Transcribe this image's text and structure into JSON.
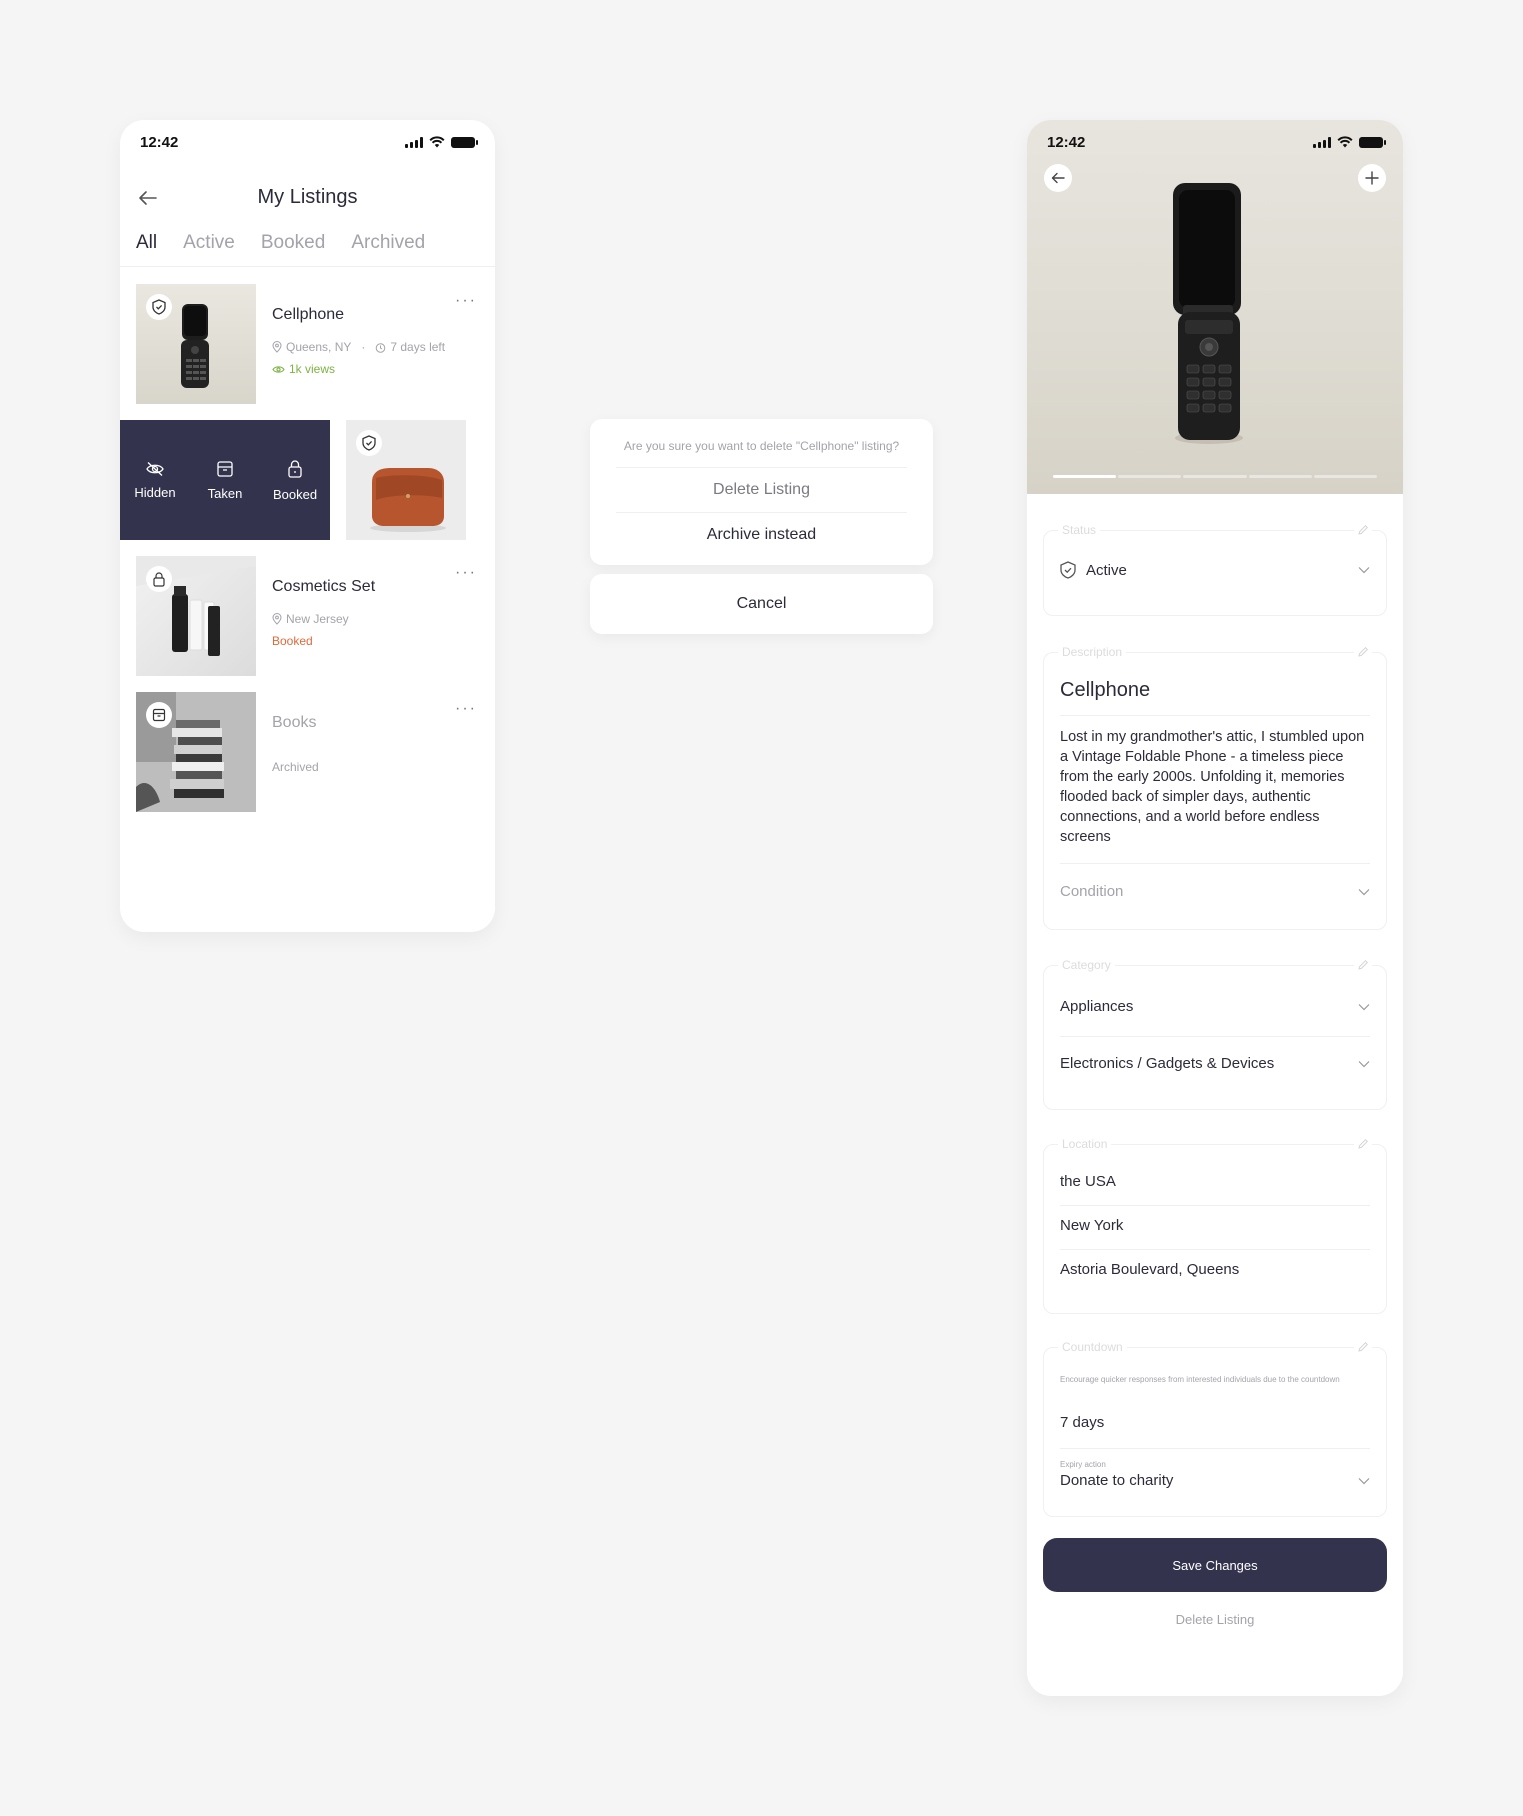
{
  "listings_screen": {
    "status_time": "12:42",
    "title": "My Listings",
    "tabs": [
      "All",
      "Active",
      "Booked",
      "Archived"
    ],
    "active_tab": "All",
    "items": [
      {
        "title": "Cellphone",
        "location": "Queens, NY",
        "countdown": "7 days left",
        "views": "1k views",
        "badge": "shield-icon"
      },
      {
        "badge": "shield-icon"
      },
      {
        "title": "Cosmetics Set",
        "location": "New Jersey",
        "status": "Booked",
        "badge": "lock-icon"
      },
      {
        "title": "Books",
        "status": "Archived",
        "badge": "archive-icon"
      }
    ],
    "swipe_actions": [
      "Hidden",
      "Taken",
      "Booked"
    ],
    "more_label": "···"
  },
  "delete_dialog": {
    "question": "Are you sure you want to delete \"Cellphone\" listing?",
    "delete_label": "Delete Listing",
    "archive_label": "Archive instead",
    "cancel_label": "Cancel"
  },
  "edit_screen": {
    "status_time": "12:42",
    "status_legend": "Status",
    "status_value": "Active",
    "description_legend": "Description",
    "title_value": "Cellphone",
    "description": "Lost in my grandmother's attic, I stumbled upon a Vintage Foldable Phone - a timeless piece from the early 2000s. Unfolding it, memories flooded back of simpler days, authentic connections, and a world before endless screens",
    "condition_placeholder": "Condition",
    "category_legend": "Category",
    "category": "Appliances",
    "subcategory": "Electronics / Gadgets & Devices",
    "location_legend": "Location",
    "country": "the USA",
    "city": "New York",
    "address": "Astoria Boulevard, Queens",
    "countdown_legend": "Countdown",
    "countdown_hint": "Encourage quicker responses from interested individuals due to the countdown",
    "countdown_value": "7 days",
    "expiry_label": "Expiry action",
    "expiry_value": "Donate to charity",
    "save_label": "Save Changes",
    "delete_label": "Delete Listing",
    "gallery_progress": {
      "current": 1,
      "total": 5
    }
  },
  "colors": {
    "accent": "#33334d",
    "views": "#7cb342",
    "booked": "#e0693a",
    "muted": "#a3a3ab"
  }
}
